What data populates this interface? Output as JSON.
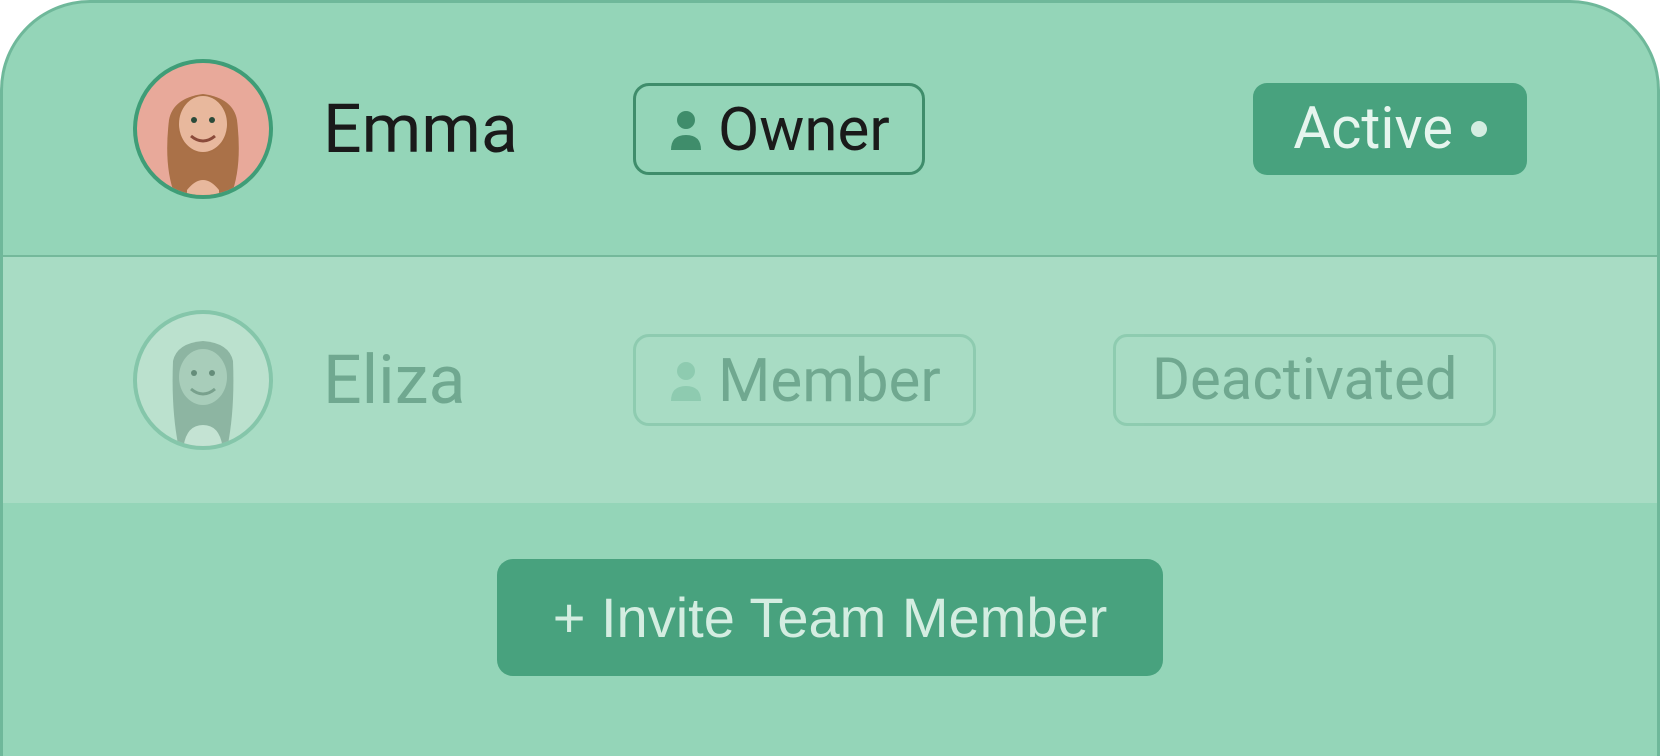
{
  "members": [
    {
      "name": "Emma",
      "role": "Owner",
      "status": "Active",
      "status_style": "solid",
      "deactivated": false
    },
    {
      "name": "Eliza",
      "role": "Member",
      "status": "Deactivated",
      "status_style": "outline",
      "deactivated": true
    }
  ],
  "actions": {
    "invite_label": "+ Invite Team Member"
  },
  "colors": {
    "panel_bg": "#94d5b8",
    "row_alt_bg": "#a8dcc4",
    "border": "#6fb89a",
    "solid_chip": "#48a27e",
    "solid_chip_text": "#e6f5ee",
    "text_dark": "#1a1a1a",
    "text_muted": "#2d6b52"
  }
}
